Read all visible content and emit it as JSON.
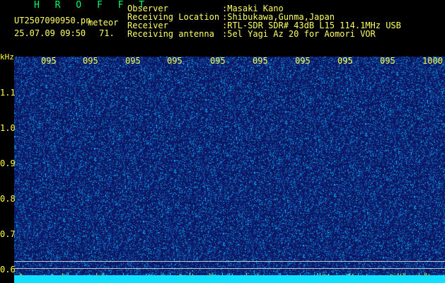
{
  "header": {
    "app_name": "H R O F F T",
    "filename": "UT2507090950.pn",
    "datetime": "25.07.09 09:50",
    "meteor_label": "meteor",
    "meteor_count": "71.",
    "info_labels": [
      "Observer",
      "Receiving Location",
      "Receiver",
      "Receiving antenna"
    ],
    "info_values": [
      ":Masaki Kano",
      ":Shibukawa,Gunma,Japan",
      ":RTL-SDR SDR# 43dB L15 114.1MHz USB",
      ":5el Yagi Az 20 for Aomori VOR"
    ]
  },
  "axis": {
    "unit": "kHz",
    "time_labels": [
      "095",
      "095",
      "095",
      "095",
      "095",
      "095",
      "095",
      "095",
      "095",
      "1000"
    ],
    "freq_labels": [
      "1.1",
      "1.0",
      "0.9",
      "0.8",
      "0.7",
      "0.6"
    ]
  },
  "colors": {
    "text": "#ffff66",
    "title": "#00ff66",
    "background": "#0b1a66",
    "baseline": "#10e0ff"
  }
}
